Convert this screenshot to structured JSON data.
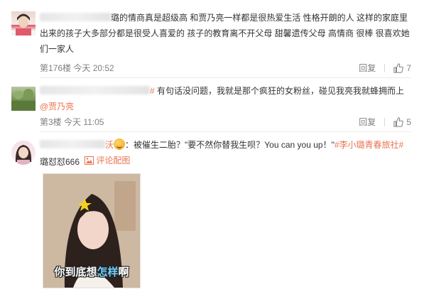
{
  "comments": [
    {
      "text_start": "璐的情商真是超级高 和贾乃亮一样都是很热爱生活 性格开朗的人 这样的家庭里出来的孩子大多部分都是很受人喜爱的 孩子的教育离不开父母 甜馨遗传父母 高情商 很棒 很喜欢她们一家人",
      "floor_time": "第176楼 今天 20:52",
      "reply_label": "回复",
      "like_count": "7"
    },
    {
      "user_suffix": "#",
      "text": "有句话没问题，我就是那个疯狂的女粉丝，碰见我亮我就蜂拥而上",
      "mention": "@贾乃亮",
      "floor_time": "第3楼 今天 11:05",
      "reply_label": "回复",
      "like_count": "5"
    },
    {
      "user_suffix": "沃",
      "text": "：被催生二胎？\"要不然你替我生呗？You can you up！\"",
      "topic": "#李小璐青春旅社#",
      "text2": "璐怼怼666",
      "image_link_label": "评论配图",
      "image_caption_a": "你到底想",
      "image_caption_b": "怎样",
      "image_caption_c": "啊"
    }
  ],
  "colors": {
    "accent": "#eb7350",
    "meta": "#808080"
  },
  "icons": {
    "like": "thumbs-up-icon",
    "image": "image-icon"
  }
}
